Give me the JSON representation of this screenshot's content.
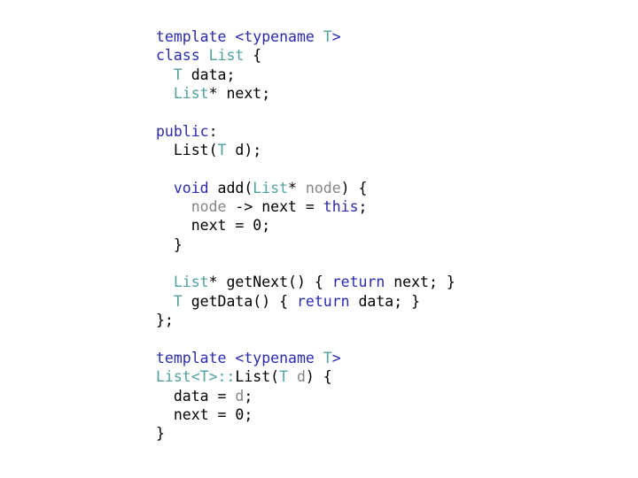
{
  "document": {
    "kind": "source-code-listing",
    "language": "C++",
    "background": "#ffffff"
  },
  "colors": {
    "keyword": "#2a2ab0",
    "type": "#50a0a0",
    "identifier": "#858585",
    "plain": "#000000",
    "background": "#ffffff"
  },
  "code": {
    "plain_text": "template <typename T>\nclass List {\n  T data;\n  List* next;\n\npublic:\n  List(T d);\n\n  void add(List* node) {\n    node -> next = this;\n    next = 0;\n  }\n\n  List* getNext() { return next; }\n  T getData() { return data; }\n};\n\ntemplate <typename T>\nList<T>::List(T d) {\n  data = d;\n  next = 0;\n}",
    "lines": [
      {
        "n": 1,
        "tokens": [
          {
            "t": "template",
            "c": "kw"
          },
          {
            "t": " <",
            "c": "kw"
          },
          {
            "t": "typename",
            "c": "kw"
          },
          {
            "t": " ",
            "c": "pl"
          },
          {
            "t": "T",
            "c": "type"
          },
          {
            "t": ">",
            "c": "kw"
          }
        ]
      },
      {
        "n": 2,
        "tokens": [
          {
            "t": "class",
            "c": "kw"
          },
          {
            "t": " ",
            "c": "pl"
          },
          {
            "t": "List",
            "c": "type"
          },
          {
            "t": " {",
            "c": "pl"
          }
        ]
      },
      {
        "n": 3,
        "tokens": [
          {
            "t": "  ",
            "c": "pl"
          },
          {
            "t": "T",
            "c": "type"
          },
          {
            "t": " data;",
            "c": "pl"
          }
        ]
      },
      {
        "n": 4,
        "tokens": [
          {
            "t": "  ",
            "c": "pl"
          },
          {
            "t": "List",
            "c": "type"
          },
          {
            "t": "* next;",
            "c": "pl"
          }
        ]
      },
      {
        "n": 5,
        "tokens": []
      },
      {
        "n": 6,
        "tokens": [
          {
            "t": "public",
            "c": "kw"
          },
          {
            "t": ":",
            "c": "pl"
          }
        ]
      },
      {
        "n": 7,
        "tokens": [
          {
            "t": "  List(",
            "c": "pl"
          },
          {
            "t": "T",
            "c": "type"
          },
          {
            "t": " d);",
            "c": "pl"
          }
        ]
      },
      {
        "n": 8,
        "tokens": []
      },
      {
        "n": 9,
        "tokens": [
          {
            "t": "  ",
            "c": "pl"
          },
          {
            "t": "void",
            "c": "kw"
          },
          {
            "t": " add(",
            "c": "pl"
          },
          {
            "t": "List",
            "c": "type"
          },
          {
            "t": "* ",
            "c": "pl"
          },
          {
            "t": "node",
            "c": "var"
          },
          {
            "t": ") {",
            "c": "pl"
          }
        ]
      },
      {
        "n": 10,
        "tokens": [
          {
            "t": "    ",
            "c": "pl"
          },
          {
            "t": "node",
            "c": "var"
          },
          {
            "t": " -> next = ",
            "c": "pl"
          },
          {
            "t": "this",
            "c": "kw"
          },
          {
            "t": ";",
            "c": "pl"
          }
        ]
      },
      {
        "n": 11,
        "tokens": [
          {
            "t": "    next = 0;",
            "c": "pl"
          }
        ]
      },
      {
        "n": 12,
        "tokens": [
          {
            "t": "  }",
            "c": "pl"
          }
        ]
      },
      {
        "n": 13,
        "tokens": []
      },
      {
        "n": 14,
        "tokens": [
          {
            "t": "  ",
            "c": "pl"
          },
          {
            "t": "List",
            "c": "type"
          },
          {
            "t": "* getNext() { ",
            "c": "pl"
          },
          {
            "t": "return",
            "c": "kw"
          },
          {
            "t": " next; }",
            "c": "pl"
          }
        ]
      },
      {
        "n": 15,
        "tokens": [
          {
            "t": "  ",
            "c": "pl"
          },
          {
            "t": "T",
            "c": "type"
          },
          {
            "t": " getData() { ",
            "c": "pl"
          },
          {
            "t": "return",
            "c": "kw"
          },
          {
            "t": " data; }",
            "c": "pl"
          }
        ]
      },
      {
        "n": 16,
        "tokens": [
          {
            "t": "};",
            "c": "pl"
          }
        ]
      },
      {
        "n": 17,
        "tokens": []
      },
      {
        "n": 18,
        "tokens": [
          {
            "t": "template",
            "c": "kw"
          },
          {
            "t": " <",
            "c": "kw"
          },
          {
            "t": "typename",
            "c": "kw"
          },
          {
            "t": " ",
            "c": "pl"
          },
          {
            "t": "T",
            "c": "type"
          },
          {
            "t": ">",
            "c": "kw"
          }
        ]
      },
      {
        "n": 19,
        "tokens": [
          {
            "t": "List<T>::",
            "c": "type"
          },
          {
            "t": "List(",
            "c": "pl"
          },
          {
            "t": "T",
            "c": "type"
          },
          {
            "t": " ",
            "c": "pl"
          },
          {
            "t": "d",
            "c": "var"
          },
          {
            "t": ") {",
            "c": "pl"
          }
        ]
      },
      {
        "n": 20,
        "tokens": [
          {
            "t": "  data = ",
            "c": "pl"
          },
          {
            "t": "d",
            "c": "var"
          },
          {
            "t": ";",
            "c": "pl"
          }
        ]
      },
      {
        "n": 21,
        "tokens": [
          {
            "t": "  next = 0;",
            "c": "pl"
          }
        ]
      },
      {
        "n": 22,
        "tokens": [
          {
            "t": "}",
            "c": "pl"
          }
        ]
      }
    ]
  }
}
